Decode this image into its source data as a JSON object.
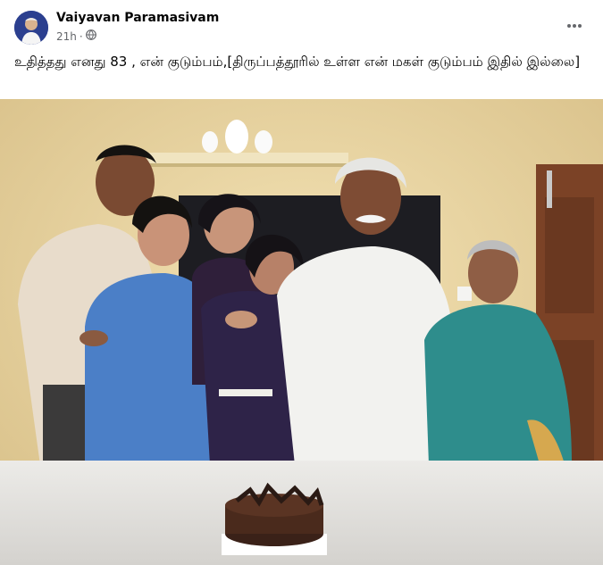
{
  "post": {
    "author": "Vaiyavan Paramasivam",
    "time": "21h",
    "separator": "·",
    "audience_icon": "globe-icon",
    "more_icon": "more-options-icon",
    "text": "உதித்தது எனது 83 , என் குடும்பம்,[திருப்பத்தூரில் உள்ள என் மகள் குடும்பம் இதில் இல்லை]"
  },
  "photo": {
    "subject": "family-photo"
  }
}
